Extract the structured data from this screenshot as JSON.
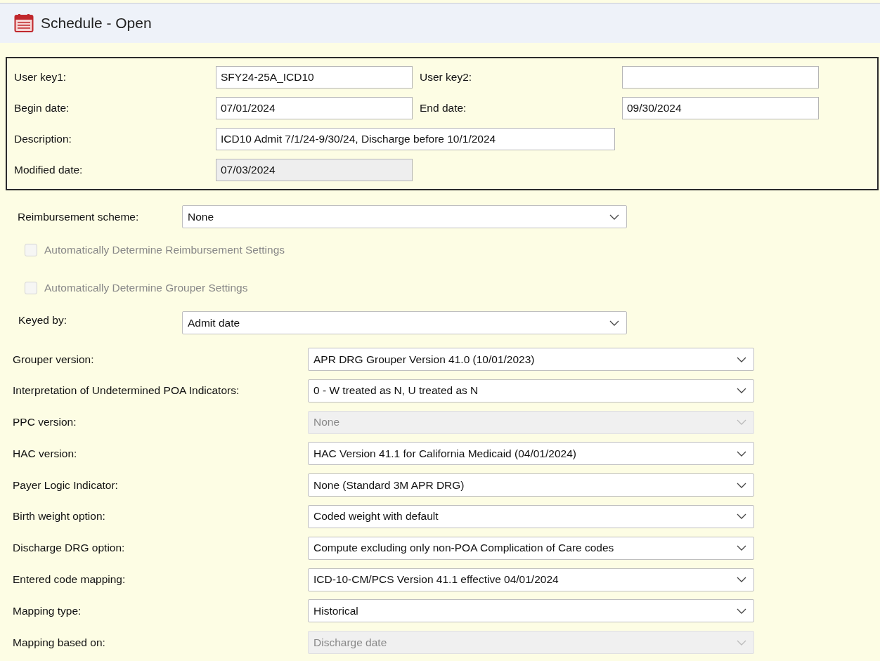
{
  "window": {
    "title": "Schedule - Open"
  },
  "header": {
    "rows": [
      [
        {
          "label": "User key1:",
          "value": "SFY24-25A_ICD10",
          "kind": "short",
          "disabled": false
        },
        {
          "label": "User key2:",
          "kind": "short",
          "disabled": false
        }
      ],
      [
        {
          "label": "Begin date:",
          "value": "07/01/2024",
          "kind": "short",
          "disabled": false
        },
        {
          "label": "End date:",
          "value": "09/30/2024",
          "kind": "short",
          "disabled": false
        }
      ],
      [
        {
          "label": "Description:",
          "value": "ICD10 Admit 7/1/24-9/30/24, Discharge before 10/1/2024",
          "kind": "long",
          "disabled": false
        }
      ],
      [
        {
          "label": "Modified date:",
          "value": "07/03/2024",
          "kind": "short",
          "disabled": true
        }
      ]
    ]
  },
  "reimbursement_scheme": {
    "label": "Reimbursement scheme:",
    "value": "None",
    "disabled": false
  },
  "checkboxes": [
    {
      "label": "Automatically Determine Reimbursement Settings",
      "checked": false,
      "disabled": true
    },
    {
      "label": "Automatically Determine Grouper Settings",
      "checked": false,
      "disabled": true
    }
  ],
  "keyed_by": {
    "label": "Keyed by:",
    "value": "Admit date",
    "disabled": false
  },
  "settings": [
    {
      "label": "Grouper version:",
      "value": "APR DRG Grouper Version 41.0 (10/01/2023)",
      "disabled": false
    },
    {
      "label": "Interpretation of Undetermined POA Indicators:",
      "value": "0 - W treated as N, U treated as N",
      "disabled": false
    },
    {
      "label": "PPC version:",
      "value": "None",
      "disabled": true
    },
    {
      "label": "HAC version:",
      "value": "HAC Version 41.1 for California Medicaid (04/01/2024)",
      "disabled": false
    },
    {
      "label": "Payer Logic Indicator:",
      "value": "None (Standard 3M APR DRG)",
      "disabled": false
    },
    {
      "label": "Birth weight option:",
      "value": "Coded weight with default",
      "disabled": false
    },
    {
      "label": "Discharge DRG option:",
      "value": "Compute excluding only non-POA Complication of Care codes",
      "disabled": false
    },
    {
      "label": "Entered code mapping:",
      "value": "ICD-10-CM/PCS Version 41.1 effective 04/01/2024",
      "disabled": false
    },
    {
      "label": "Mapping type:",
      "value": "Historical",
      "disabled": false
    },
    {
      "label": "Mapping based on:",
      "value": "Discharge date",
      "disabled": true
    }
  ]
}
